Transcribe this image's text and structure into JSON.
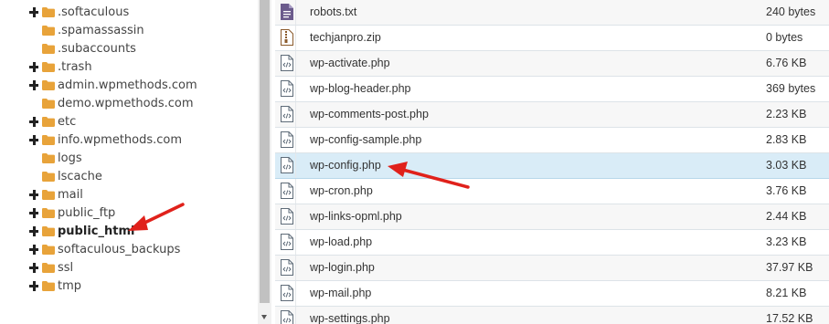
{
  "tree": {
    "items": [
      {
        "label": ".softaculous",
        "expandable": true,
        "bold": false
      },
      {
        "label": ".spamassassin",
        "expandable": false,
        "bold": false
      },
      {
        "label": ".subaccounts",
        "expandable": false,
        "bold": false
      },
      {
        "label": ".trash",
        "expandable": true,
        "bold": false
      },
      {
        "label": "admin.wpmethods.com",
        "expandable": true,
        "bold": false
      },
      {
        "label": "demo.wpmethods.com",
        "expandable": false,
        "bold": false
      },
      {
        "label": "etc",
        "expandable": true,
        "bold": false
      },
      {
        "label": "info.wpmethods.com",
        "expandable": true,
        "bold": false
      },
      {
        "label": "logs",
        "expandable": false,
        "bold": false
      },
      {
        "label": "lscache",
        "expandable": false,
        "bold": false
      },
      {
        "label": "mail",
        "expandable": true,
        "bold": false
      },
      {
        "label": "public_ftp",
        "expandable": true,
        "bold": false
      },
      {
        "label": "public_html",
        "expandable": true,
        "bold": true
      },
      {
        "label": "softaculous_backups",
        "expandable": true,
        "bold": false
      },
      {
        "label": "ssl",
        "expandable": true,
        "bold": false
      },
      {
        "label": "tmp",
        "expandable": true,
        "bold": false
      }
    ]
  },
  "files": {
    "rows": [
      {
        "name": "robots.txt",
        "size": "240 bytes",
        "icon": "text-file-icon",
        "selected": false
      },
      {
        "name": "techjanpro.zip",
        "size": "0 bytes",
        "icon": "zip-file-icon",
        "selected": false
      },
      {
        "name": "wp-activate.php",
        "size": "6.76 KB",
        "icon": "code-file-icon",
        "selected": false
      },
      {
        "name": "wp-blog-header.php",
        "size": "369 bytes",
        "icon": "code-file-icon",
        "selected": false
      },
      {
        "name": "wp-comments-post.php",
        "size": "2.23 KB",
        "icon": "code-file-icon",
        "selected": false
      },
      {
        "name": "wp-config-sample.php",
        "size": "2.83 KB",
        "icon": "code-file-icon",
        "selected": false
      },
      {
        "name": "wp-config.php",
        "size": "3.03 KB",
        "icon": "code-file-icon",
        "selected": true
      },
      {
        "name": "wp-cron.php",
        "size": "3.76 KB",
        "icon": "code-file-icon",
        "selected": false
      },
      {
        "name": "wp-links-opml.php",
        "size": "2.44 KB",
        "icon": "code-file-icon",
        "selected": false
      },
      {
        "name": "wp-load.php",
        "size": "3.23 KB",
        "icon": "code-file-icon",
        "selected": false
      },
      {
        "name": "wp-login.php",
        "size": "37.97 KB",
        "icon": "code-file-icon",
        "selected": false
      },
      {
        "name": "wp-mail.php",
        "size": "8.21 KB",
        "icon": "code-file-icon",
        "selected": false
      },
      {
        "name": "wp-settings.php",
        "size": "17.52 KB",
        "icon": "code-file-icon",
        "selected": false
      }
    ]
  },
  "colors": {
    "folder": "#e8a33a",
    "selected_row": "#d9ecf7",
    "annotation_arrow": "#e0211b",
    "text_file_icon": "#6b5b8c",
    "zip_file_icon": "#8a5a2b"
  }
}
